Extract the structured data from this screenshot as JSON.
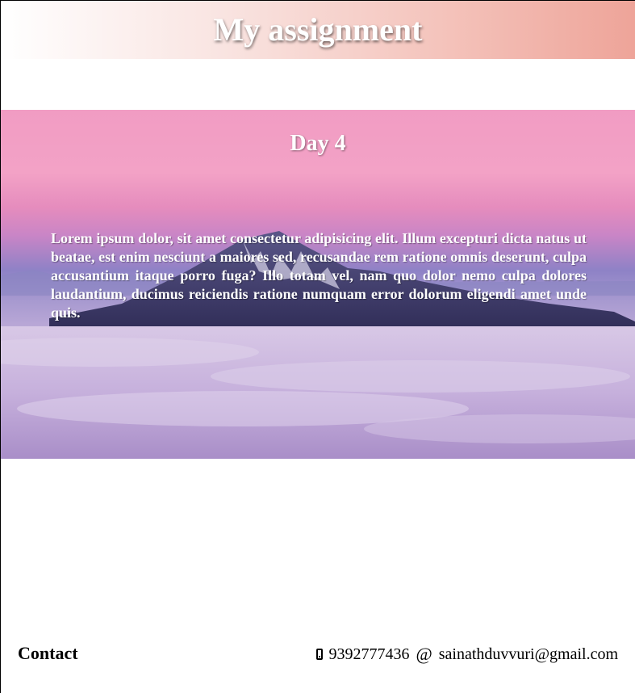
{
  "header": {
    "title": "My assignment"
  },
  "hero": {
    "heading": "Day 4",
    "body": "Lorem ipsum dolor, sit amet consectetur adipisicing elit. Illum excepturi dicta natus ut beatae, est enim nesciunt a maiores sed, recusandae rem ratione omnis deserunt, culpa accusantium itaque porro fuga? Illo totam vel, nam quo dolor nemo culpa dolores laudantium, ducimus reiciendis ratione numquam error dolorum eligendi amet unde quis.",
    "image_icon": "mountain-clouds-background"
  },
  "footer": {
    "contact_label": "Contact",
    "phone_icon": "mobile-phone-icon",
    "phone": "9392777436",
    "email_icon": "at-icon",
    "email": "sainathduvvuri@gmail.com"
  },
  "colors": {
    "header_gradient_end": "#eea499",
    "sky_pink": "#f19cc3",
    "cloud_lavender": "#c8b3dc",
    "mountain_dark": "#3d3a6a"
  }
}
